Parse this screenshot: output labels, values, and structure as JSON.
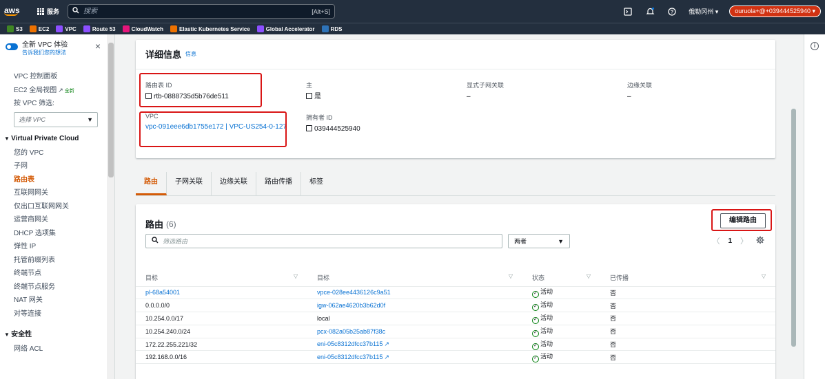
{
  "topbar": {
    "logo": "aws",
    "services_label": "服务",
    "search_placeholder": "搜索",
    "search_shortcut": "[Alt+S]",
    "region": "俄勒冈州 ▾",
    "account": "ouruola+@+039444525940 ▾"
  },
  "favorites": [
    {
      "label": "S3",
      "color": "#3f8624"
    },
    {
      "label": "EC2",
      "color": "#ed7100"
    },
    {
      "label": "VPC",
      "color": "#8c4fff"
    },
    {
      "label": "Route 53",
      "color": "#8c4fff"
    },
    {
      "label": "CloudWatch",
      "color": "#e7157b"
    },
    {
      "label": "Elastic Kubernetes Service",
      "color": "#ed7100"
    },
    {
      "label": "Global Accelerator",
      "color": "#8c4fff"
    },
    {
      "label": "RDS",
      "color": "#2e73b8"
    }
  ],
  "sidebar": {
    "toggle_title": "全新 VPC 体验",
    "toggle_link": "告诉我们您的想法",
    "close": "×",
    "dashboard": "VPC 控制面板",
    "ec2_global": "EC2 全局视图",
    "ec2_new": "全新",
    "filter_label": "按 VPC 筛选:",
    "select_placeholder": "选择 VPC",
    "section_vpc": "Virtual Private Cloud",
    "items": [
      "您的 VPC",
      "子网",
      "路由表",
      "互联网网关",
      "仅出口互联网网关",
      "运营商网关",
      "DHCP 选项集",
      "弹性 IP",
      "托管前缀列表",
      "终端节点",
      "终端节点服务",
      "NAT 网关",
      "对等连接"
    ],
    "active_index": 2,
    "section_security": "安全性",
    "security_items": [
      "网络 ACL"
    ]
  },
  "details": {
    "title": "详细信息",
    "info": "信息",
    "route_table_id_label": "路由表 ID",
    "route_table_id": "rtb-0888735d5b76de511",
    "main_label": "主",
    "main_value": "是",
    "explicit_subnet_label": "显式子网关联",
    "explicit_subnet_value": "–",
    "edge_assoc_label": "边缘关联",
    "edge_assoc_value": "–",
    "vpc_label": "VPC",
    "vpc_value": "vpc-091eee6db1755e172 | VPC-US254-0-127",
    "owner_label": "拥有者 ID",
    "owner_value": "039444525940"
  },
  "tabs": [
    "路由",
    "子网关联",
    "边缘关联",
    "路由传播",
    "标签"
  ],
  "routes": {
    "title": "路由",
    "count": "(6)",
    "edit_button": "编辑路由",
    "filter_placeholder": "筛选路由",
    "select_value": "两者",
    "page": "1",
    "columns": [
      "目标",
      "目标",
      "状态",
      "已传播"
    ],
    "rows": [
      {
        "destination": "pl-68a54001",
        "dest_link": true,
        "target": "vpce-028ee4436126c9a51",
        "target_link": true,
        "target_ext": false,
        "status": "活动",
        "propagated": "否"
      },
      {
        "destination": "0.0.0.0/0",
        "dest_link": false,
        "target": "igw-062ae4620b3b62d0f",
        "target_link": true,
        "target_ext": false,
        "status": "活动",
        "propagated": "否"
      },
      {
        "destination": "10.254.0.0/17",
        "dest_link": false,
        "target": "local",
        "target_link": false,
        "target_ext": false,
        "status": "活动",
        "propagated": "否"
      },
      {
        "destination": "10.254.240.0/24",
        "dest_link": false,
        "target": "pcx-082a05b25ab87f38c",
        "target_link": true,
        "target_ext": false,
        "status": "活动",
        "propagated": "否"
      },
      {
        "destination": "172.22.255.221/32",
        "dest_link": false,
        "target": "eni-05c8312dfcc37b115",
        "target_link": true,
        "target_ext": true,
        "status": "活动",
        "propagated": "否"
      },
      {
        "destination": "192.168.0.0/16",
        "dest_link": false,
        "target": "eni-05c8312dfcc37b115",
        "target_link": true,
        "target_ext": true,
        "status": "活动",
        "propagated": "否"
      }
    ]
  }
}
